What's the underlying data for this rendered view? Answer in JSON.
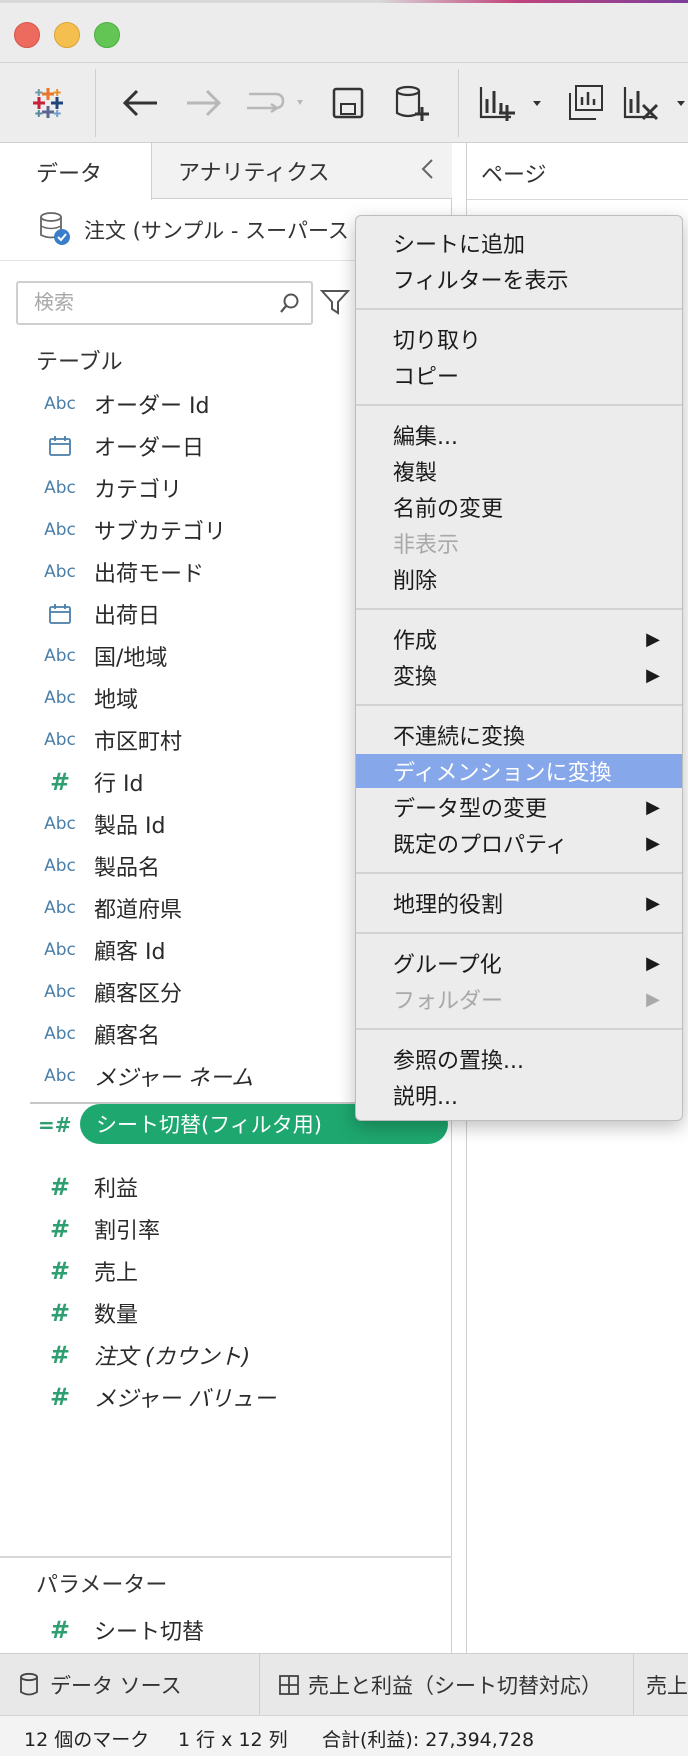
{
  "toolbar": {
    "items": [
      {
        "name": "tableau-logo-icon"
      },
      {
        "name": "back-arrow-icon"
      },
      {
        "name": "forward-arrow-icon"
      },
      {
        "name": "redo-icon"
      },
      {
        "name": "save-icon"
      },
      {
        "name": "new-datasource-icon"
      },
      {
        "name": "new-worksheet-icon"
      },
      {
        "name": "duplicate-sheet-icon"
      },
      {
        "name": "clear-sheet-icon"
      }
    ]
  },
  "left_pane": {
    "tabs": {
      "data": "データ",
      "analytics": "アナリティクス"
    },
    "datasource": "注文 (サンプル - スーパース",
    "search_placeholder": "検索",
    "tables_title": "テーブル",
    "type_labels": {
      "abc": "Abc",
      "num": "#",
      "filter": "=#"
    },
    "fields": [
      {
        "name": "オーダー Id",
        "type": "abc"
      },
      {
        "name": "オーダー日",
        "type": "date"
      },
      {
        "name": "カテゴリ",
        "type": "abc"
      },
      {
        "name": "サブカテゴリ",
        "type": "abc"
      },
      {
        "name": "出荷モード",
        "type": "abc"
      },
      {
        "name": "出荷日",
        "type": "date"
      },
      {
        "name": "国/地域",
        "type": "abc"
      },
      {
        "name": "地域",
        "type": "abc"
      },
      {
        "name": "市区町村",
        "type": "abc"
      },
      {
        "name": "行 Id",
        "type": "num"
      },
      {
        "name": "製品 Id",
        "type": "abc"
      },
      {
        "name": "製品名",
        "type": "abc"
      },
      {
        "name": "都道府県",
        "type": "abc"
      },
      {
        "name": "顧客 Id",
        "type": "abc"
      },
      {
        "name": "顧客区分",
        "type": "abc"
      },
      {
        "name": "顧客名",
        "type": "abc"
      },
      {
        "name": "メジャー ネーム",
        "type": "abc",
        "italic": true
      }
    ],
    "selected_field": "シート切替(フィルタ用)",
    "measures": [
      {
        "name": "利益"
      },
      {
        "name": "割引率"
      },
      {
        "name": "売上"
      },
      {
        "name": "数量"
      },
      {
        "name": "注文 (カウント)",
        "italic": true
      },
      {
        "name": "メジャー バリュー",
        "italic": true
      }
    ],
    "parameters_title": "パラメーター",
    "parameters": [
      {
        "name": "シート切替"
      }
    ]
  },
  "right_pane": {
    "pages_label": "ページ"
  },
  "context_menu": {
    "groups": [
      [
        {
          "label": "シートに追加"
        },
        {
          "label": "フィルターを表示"
        }
      ],
      [
        {
          "label": "切り取り"
        },
        {
          "label": "コピー"
        }
      ],
      [
        {
          "label": "編集..."
        },
        {
          "label": "複製"
        },
        {
          "label": "名前の変更"
        },
        {
          "label": "非表示",
          "disabled": true
        },
        {
          "label": "削除"
        }
      ],
      [
        {
          "label": "作成",
          "submenu": true
        },
        {
          "label": "変換",
          "submenu": true
        }
      ],
      [
        {
          "label": "不連続に変換"
        },
        {
          "label": "ディメンションに変換",
          "active": true
        },
        {
          "label": "データ型の変更",
          "submenu": true
        },
        {
          "label": "既定のプロパティ",
          "submenu": true
        }
      ],
      [
        {
          "label": "地理的役割",
          "submenu": true
        }
      ],
      [
        {
          "label": "グループ化",
          "submenu": true
        },
        {
          "label": "フォルダー",
          "submenu": true,
          "disabled": true
        }
      ],
      [
        {
          "label": "参照の置換..."
        },
        {
          "label": "説明..."
        }
      ]
    ],
    "submenu_arrow": "▶"
  },
  "bottom_tabs": {
    "datasource": "データ ソース",
    "sheet1": "売上と利益（シート切替対応）",
    "sheet2": "売上"
  },
  "status": {
    "marks": "12 個のマーク",
    "dims": "1 行 x 12 列",
    "sum": "合計(利益): 27,394,728"
  },
  "colors": {
    "pill": "#1ea76f",
    "menu_highlight": "#86a8ea",
    "abc_icon": "#4a7ea8",
    "measure_icon": "#2f9e70"
  }
}
